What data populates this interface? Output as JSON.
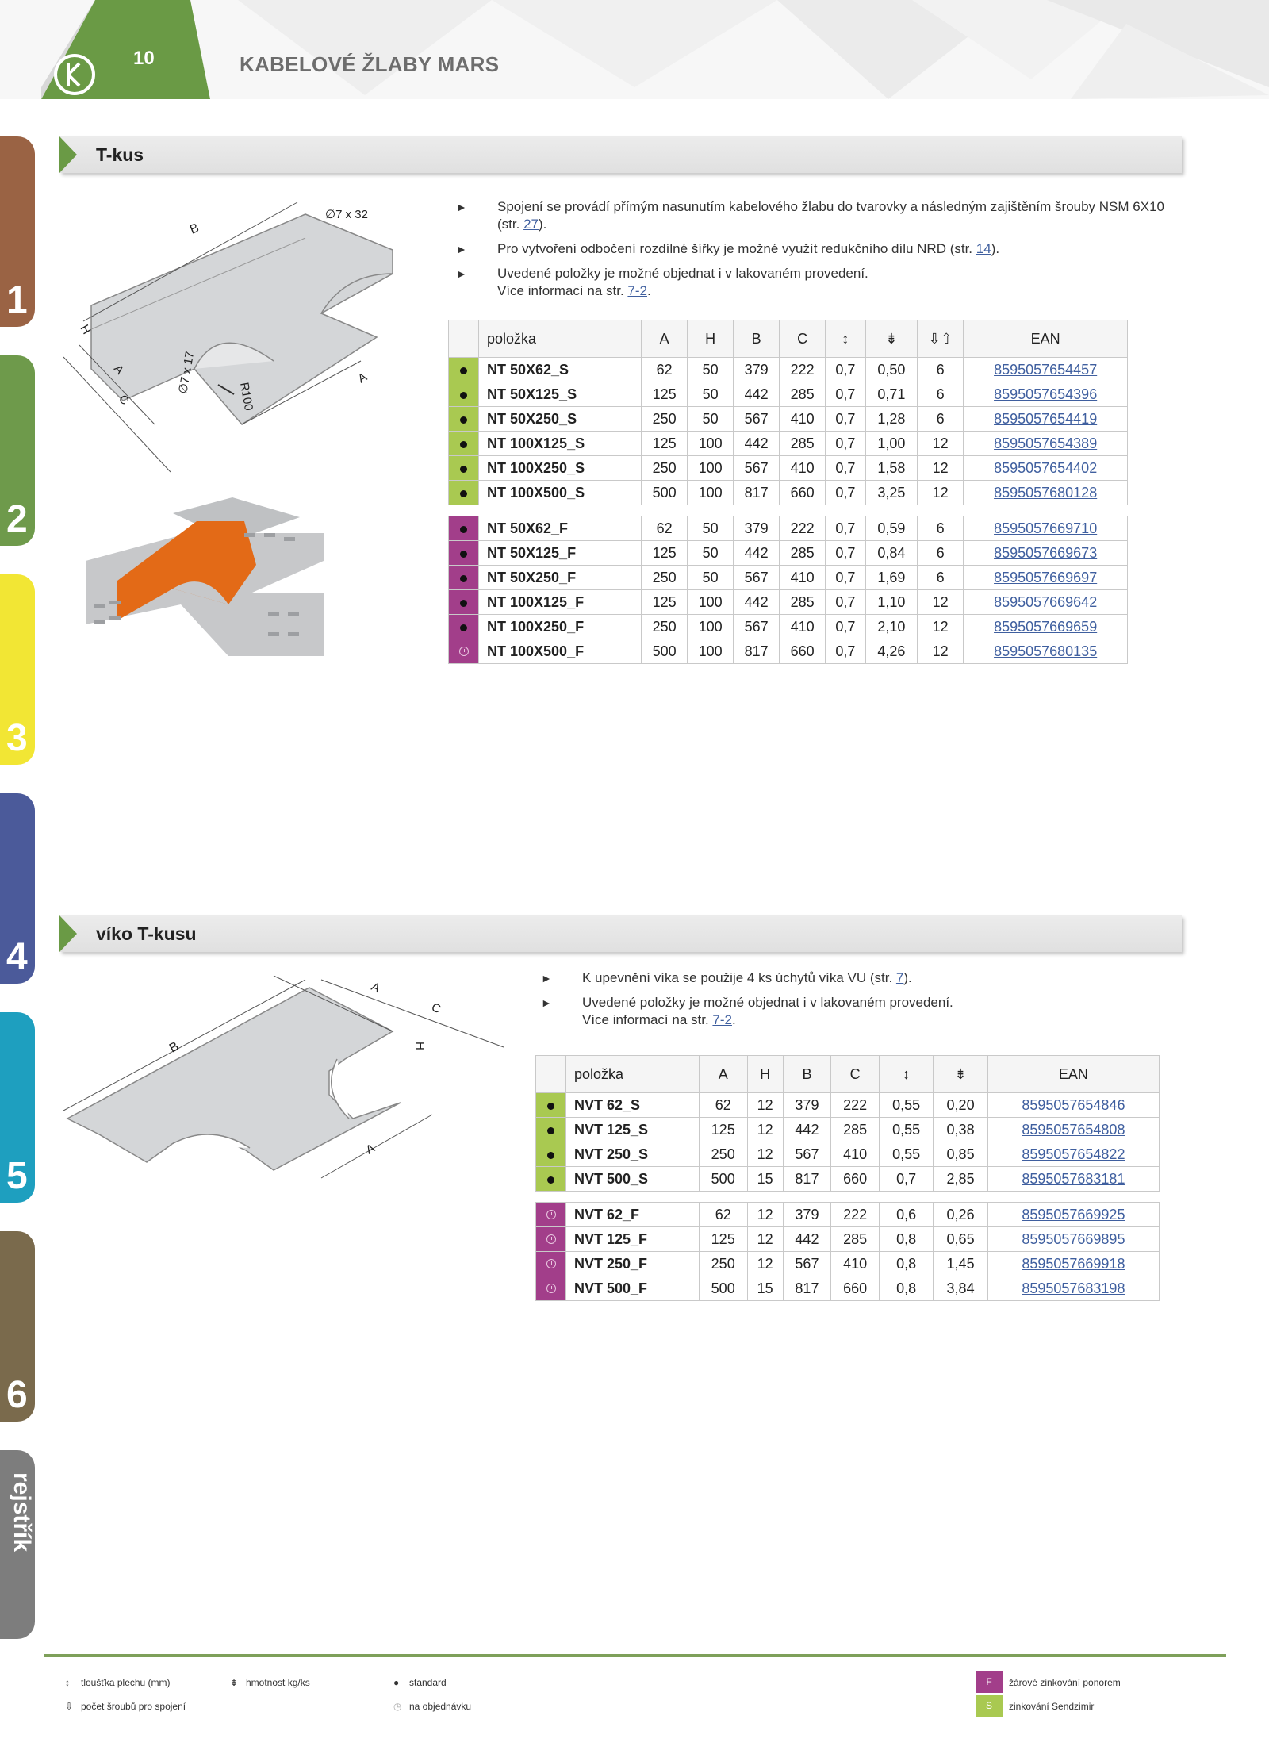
{
  "header": {
    "page_number": "10",
    "title": "KABELOVÉ ŽLABY MARS"
  },
  "side_tabs": [
    {
      "label": "1",
      "color": "#9a6344"
    },
    {
      "label": "2",
      "color": "#6e9a4b"
    },
    {
      "label": "3",
      "color": "#f2e634"
    },
    {
      "label": "4",
      "color": "#4b5a9a"
    },
    {
      "label": "5",
      "color": "#1e9fbf"
    },
    {
      "label": "6",
      "color": "#7a6a4c"
    },
    {
      "label": "rejstřík",
      "color": "#7d7d7d"
    }
  ],
  "section1": {
    "title": "T-kus",
    "drawing_labels": {
      "b": "B",
      "hole_top": "∅7 x 32",
      "h": "H",
      "a_left": "A",
      "c": "C",
      "hole_bottom": "∅7 x 17",
      "radius": "R100",
      "a_right": "A"
    },
    "bullets": [
      {
        "text": "Spojení se provádí přímým nasunutím kabelového žlabu do tvarovky a následným zajištěním šrouby NSM 6X10 (str. ",
        "link": "27",
        "after": ")."
      },
      {
        "text": "Pro vytvoření odbočení rozdílné šířky je možné využít redukčního dílu NRD (str. ",
        "link": "14",
        "after": ")."
      },
      {
        "text": "Uvedené položky je možné objednat i v lakovaném provedení.\nVíce informací na str. ",
        "link": "7-2",
        "after": "."
      }
    ],
    "table": {
      "headers": [
        "položka",
        "A",
        "H",
        "B",
        "C",
        "↕",
        "⇟",
        "⇩⇧"
      ],
      "ean_header": "EAN",
      "rows_s": [
        [
          "NT 50X62_S",
          "62",
          "50",
          "379",
          "222",
          "0,7",
          "0,50",
          "6",
          "8595057654457"
        ],
        [
          "NT 50X125_S",
          "125",
          "50",
          "442",
          "285",
          "0,7",
          "0,71",
          "6",
          "8595057654396"
        ],
        [
          "NT 50X250_S",
          "250",
          "50",
          "567",
          "410",
          "0,7",
          "1,28",
          "6",
          "8595057654419"
        ],
        [
          "NT 100X125_S",
          "125",
          "100",
          "442",
          "285",
          "0,7",
          "1,00",
          "12",
          "8595057654389"
        ],
        [
          "NT 100X250_S",
          "250",
          "100",
          "567",
          "410",
          "0,7",
          "1,58",
          "12",
          "8595057654402"
        ],
        [
          "NT 100X500_S",
          "500",
          "100",
          "817",
          "660",
          "0,7",
          "3,25",
          "12",
          "8595057680128"
        ]
      ],
      "rows_f": [
        [
          "NT 50X62_F",
          "62",
          "50",
          "379",
          "222",
          "0,7",
          "0,59",
          "6",
          "8595057669710"
        ],
        [
          "NT 50X125_F",
          "125",
          "50",
          "442",
          "285",
          "0,7",
          "0,84",
          "6",
          "8595057669673"
        ],
        [
          "NT 50X250_F",
          "250",
          "50",
          "567",
          "410",
          "0,7",
          "1,69",
          "6",
          "8595057669697"
        ],
        [
          "NT 100X125_F",
          "125",
          "100",
          "442",
          "285",
          "0,7",
          "1,10",
          "12",
          "8595057669642"
        ],
        [
          "NT 100X250_F",
          "250",
          "100",
          "567",
          "410",
          "0,7",
          "2,10",
          "12",
          "8595057669659"
        ],
        [
          "NT 100X500_F",
          "500",
          "100",
          "817",
          "660",
          "0,7",
          "4,26",
          "12",
          "8595057680135"
        ]
      ]
    }
  },
  "section2": {
    "title": "víko T-kusu",
    "drawing_labels": {
      "a_top": "A",
      "c": "C",
      "h": "H",
      "b": "B",
      "a_bottom": "A"
    },
    "bullets": [
      {
        "text": "K upevnění víka se použije 4 ks úchytů víka VU (str. ",
        "link": "7",
        "after": ")."
      },
      {
        "text": "Uvedené položky je možné objednat i v lakovaném provedení.\nVíce informací na str. ",
        "link": "7-2",
        "after": "."
      }
    ],
    "table": {
      "headers": [
        "položka",
        "A",
        "H",
        "B",
        "C",
        "↕",
        "⇟"
      ],
      "ean_header": "EAN",
      "rows_s": [
        [
          "NVT 62_S",
          "62",
          "12",
          "379",
          "222",
          "0,55",
          "0,20",
          "8595057654846"
        ],
        [
          "NVT 125_S",
          "125",
          "12",
          "442",
          "285",
          "0,55",
          "0,38",
          "8595057654808"
        ],
        [
          "NVT 250_S",
          "250",
          "12",
          "567",
          "410",
          "0,55",
          "0,85",
          "8595057654822"
        ],
        [
          "NVT 500_S",
          "500",
          "15",
          "817",
          "660",
          "0,7",
          "2,85",
          "8595057683181"
        ]
      ],
      "rows_f": [
        [
          "NVT 62_F",
          "62",
          "12",
          "379",
          "222",
          "0,6",
          "0,26",
          "8595057669925"
        ],
        [
          "NVT 125_F",
          "125",
          "12",
          "442",
          "285",
          "0,8",
          "0,65",
          "8595057669895"
        ],
        [
          "NVT 250_F",
          "250",
          "12",
          "567",
          "410",
          "0,8",
          "1,45",
          "8595057669918"
        ],
        [
          "NVT 500_F",
          "500",
          "15",
          "817",
          "660",
          "0,8",
          "3,84",
          "8595057683198"
        ]
      ]
    }
  },
  "legend": {
    "thickness": "tloušťka plechu (mm)",
    "weight": "hmotnost kg/ks",
    "standard": "standard",
    "screws": "počet šroubů pro spojení",
    "on_order": "na objednávku",
    "f_box": "F",
    "f_text": "žárové zinkování ponorem",
    "s_box": "S",
    "s_text": "zinkování Sendzimir"
  },
  "colors": {
    "accent_green": "#6a9a45",
    "s_green": "#a9c951",
    "f_purple": "#a23e8a",
    "link_blue": "#3f5f9f"
  }
}
